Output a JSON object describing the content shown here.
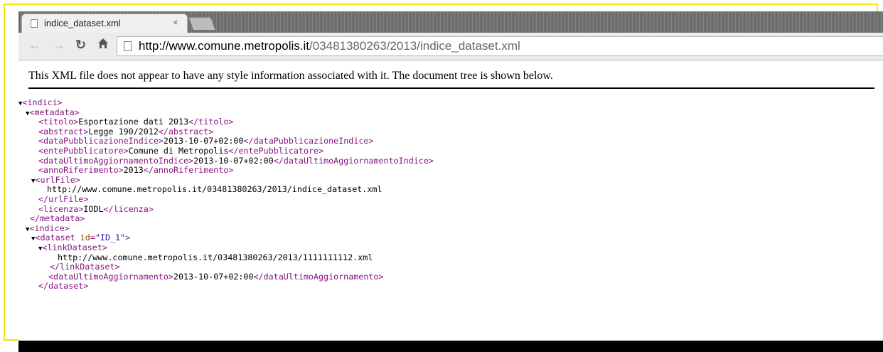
{
  "browser": {
    "tab_title": "indice_dataset.xml",
    "tab_close": "×",
    "url_host": "http://www.comune.metropolis.it",
    "url_path": "/03481380263/2013/indice_dataset.xml"
  },
  "info_text": "This XML file does not appear to have any style information associated with it. The document tree is shown below.",
  "xml": {
    "root_open": "<indici>",
    "metadata_open": "<metadata>",
    "titolo": {
      "open": "<titolo>",
      "value": "Esportazione dati 2013",
      "close": "</titolo>"
    },
    "abstract": {
      "open": "<abstract>",
      "value": "Legge 190/2012",
      "close": "</abstract>"
    },
    "dataPubblicazioneIndice": {
      "open": "<dataPubblicazioneIndice>",
      "value": "2013-10-07+02:00",
      "close": "</dataPubblicazioneIndice>"
    },
    "entePubblicatore": {
      "open": "<entePubblicatore>",
      "value": "Comune di Metropolis",
      "close": "</entePubblicatore>"
    },
    "dataUltimoAggiornamentoIndice": {
      "open": "<dataUltimoAggiornamentoIndice>",
      "value": "2013-10-07+02:00",
      "close": "</dataUltimoAggiornamentoIndice>"
    },
    "annoRiferimento": {
      "open": "<annoRiferimento>",
      "value": "2013",
      "close": "</annoRiferimento>"
    },
    "urlFile": {
      "open": "<urlFile>",
      "value": "http://www.comune.metropolis.it/03481380263/2013/indice_dataset.xml",
      "close": "</urlFile>"
    },
    "licenza": {
      "open": "<licenza>",
      "value": "IODL",
      "close": "</licenza>"
    },
    "metadata_close": "</metadata>",
    "indice_open": "<indice>",
    "dataset": {
      "open_prefix": "<dataset ",
      "attr_name": "id",
      "attr_eq": "=",
      "attr_value": "\"ID_1\"",
      "open_suffix": ">",
      "close": "</dataset>"
    },
    "linkDataset": {
      "open": "<linkDataset>",
      "value": "http://www.comune.metropolis.it/03481380263/2013/1111111112.xml",
      "close": "</linkDataset>"
    },
    "dataUltimoAggiornamento": {
      "open": "<dataUltimoAggiornamento>",
      "value": "2013-10-07+02:00",
      "close": "</dataUltimoAggiornamento>"
    },
    "toggle": "▼"
  },
  "icons": {
    "back": "back-arrow-icon",
    "forward": "forward-arrow-icon",
    "reload": "reload-icon",
    "home": "home-icon",
    "page": "page-icon",
    "expand": "expand-triangle-icon"
  },
  "colors": {
    "tag": "#881280",
    "attr_name": "#994500",
    "attr_value": "#1a1aa6",
    "frame": "#f2e600"
  }
}
